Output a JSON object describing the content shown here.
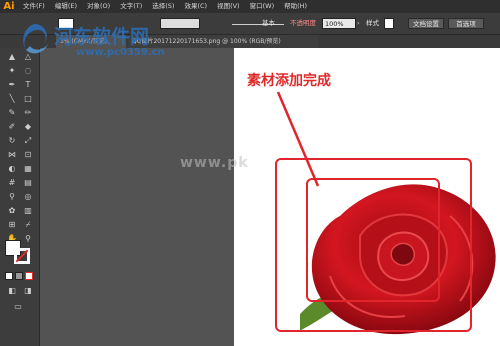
{
  "app": {
    "logo": "Ai"
  },
  "menu": [
    "文件(F)",
    "编辑(E)",
    "对象(O)",
    "文字(T)",
    "选择(S)",
    "效果(C)",
    "视图(V)",
    "窗口(W)",
    "帮助(H)"
  ],
  "control": {
    "stroke_style": "基本",
    "opacity_label": "不透明度",
    "opacity_value": "100%",
    "style_label": "样式",
    "doc_setup": "文档设置",
    "preferences": "首选项"
  },
  "tabs": {
    "tab1": "3% (CMYK/预览)",
    "tab2": "QQ图片20171220171653.png @ 100% (RGB/预览)"
  },
  "watermark": {
    "title": "河东软件网",
    "url": "www.pc0359.cn",
    "center": "www.pk"
  },
  "annotation": "素材添加完成",
  "colors": {
    "accent": "#ff9a00",
    "annotation": "#e02929",
    "watermark": "#2b6fb7"
  }
}
